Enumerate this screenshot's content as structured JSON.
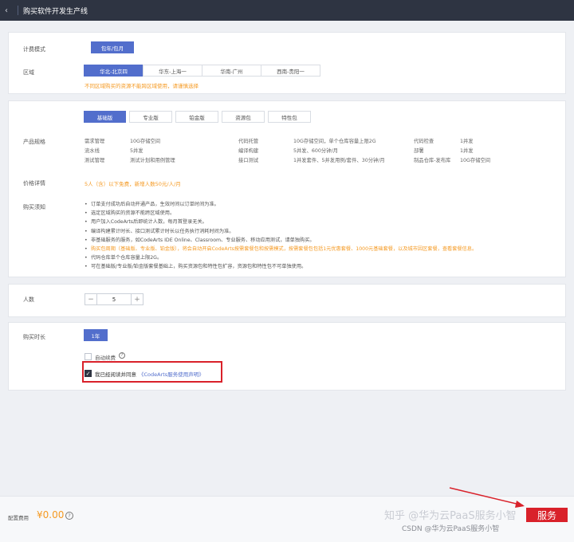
{
  "header": {
    "back_icon": "chevron-left-icon",
    "title": "购买软件开发生产线"
  },
  "billing": {
    "label": "计费模式",
    "option": "包年/包月"
  },
  "region": {
    "label": "区域",
    "options": [
      "华北-北京四",
      "华东-上海一",
      "华南-广州",
      "西南-贵阳一"
    ],
    "selected": 0,
    "hint": "不同区域购买的资源不能跨区域使用，请谨慎选择"
  },
  "editions": {
    "tabs": [
      "基础版",
      "专业版",
      "铂金版",
      "资源包",
      "特性包"
    ],
    "selected": 0
  },
  "specs": {
    "label": "产品规格",
    "rows": [
      [
        "需求管理",
        "10G存储空间",
        "代码托管",
        "10G存储空间，单个仓库容量上限2G",
        "代码检查",
        "1并发"
      ],
      [
        "流水线",
        "5并发",
        "编译构建",
        "5并发、600分钟/月",
        "部署",
        "1并发"
      ],
      [
        "测试管理",
        "测试计划和用例管理",
        "接口测试",
        "1并发套件、5并发用例/套件、30分钟/月",
        "制品仓库-发布库",
        "10G存储空间"
      ]
    ]
  },
  "price_detail": {
    "label": "价格详情",
    "text": "5人（含）以下免费，新增人数50元/人/月"
  },
  "purchase_notes": {
    "label": "购买须知",
    "items": [
      "订单支付成功后自动开通产品，生效时间以订单时间为准。",
      "选定区域购买的资源不能跨区域使用。",
      "用户加入CodeArts后即统计人数，每月首登录无关。",
      "编译构建累计时长、接口测试累计时长以任务执行消耗时间为准。",
      "非基础服务的服务，如CodeArts IDE Online、Classroom、专业服务、移动应用测试，请单独购买。",
      "购买包周期（基础版、专业版、铂金版），将会自动开启CodeArts按需套餐包和按需模式，按需套餐包包括1元优惠套餐、1000元基础套餐，以及城市因区套餐，查看套餐信息。",
      "代码仓库单个仓库容量上限2G。",
      "可在基础版/专业版/铂金版套餐基础上，购买资源包和特性包扩容，资源包和特性包不可单独使用。"
    ]
  },
  "headcount": {
    "label": "人数",
    "minus": "−",
    "value": "5",
    "plus": "+"
  },
  "duration": {
    "label": "购买时长",
    "option": "1年",
    "auto_renew": "自动续费",
    "help_icon": "question-circle-icon",
    "agree_prefix": "我已经阅读并同意",
    "agree_link": "《CodeArts服务使用声明》",
    "agree_checked": true
  },
  "footer": {
    "fee_label": "配置费用",
    "fee_value": "¥0.00",
    "help_icon": "question-circle-icon",
    "buy_label": "服务"
  },
  "watermarks": [
    "知乎 @华为云PaaS服务小智",
    "CSDN @华为云PaaS服务小智"
  ],
  "colors": {
    "accent": "#526ecc",
    "warning": "#f59a23",
    "danger": "#d9212a",
    "header": "#2e3442"
  }
}
